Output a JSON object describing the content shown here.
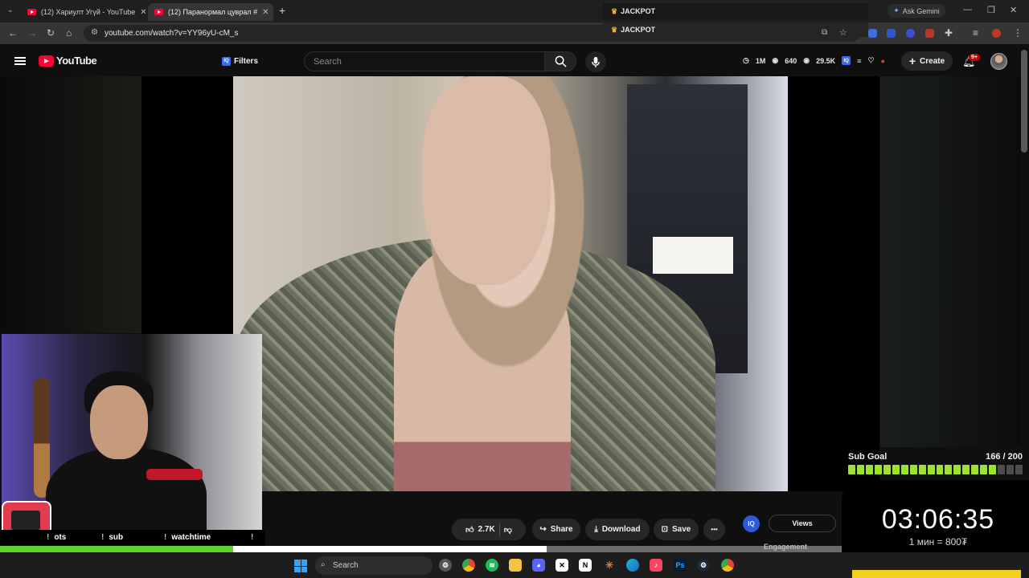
{
  "browser": {
    "tabs": [
      {
        "label": "(12) Хариулт Угүй - YouTube",
        "active": false
      },
      {
        "label": "(12) Паранормал цуврал #",
        "active": true
      }
    ],
    "new_tab": "+",
    "ask_gemini": "Ask Gemini",
    "url": "youtube.com/watch?v=YY96yU-cM_s",
    "popup_items": [
      "JACKPOT",
      "JACKPOT"
    ]
  },
  "youtube": {
    "logo_text": "YouTube",
    "filters_label": "Filters",
    "search_placeholder": "Search",
    "stats": {
      "subs": "1M",
      "views_a": "640",
      "views_b": "29.5K"
    },
    "create_label": "Create",
    "notifications_badge": "9+"
  },
  "actions": {
    "like_count": "2.7K",
    "share_label": "Share",
    "download_label": "Download",
    "save_label": "Save",
    "more_label": "•••"
  },
  "extension": {
    "iq_label": "IQ",
    "views_chip": "Views",
    "engagement_label": "Engagement"
  },
  "stream_overlay": {
    "commands": [
      {
        "bang": "!",
        "text": "ots"
      },
      {
        "bang": "!",
        "text": "sub"
      },
      {
        "bang": "!",
        "text": "watchtime"
      },
      {
        "bang": "!",
        "text": ""
      }
    ],
    "sub_goal": {
      "title": "Sub Goal",
      "count": "166 / 200",
      "current": 166,
      "target": 200
    },
    "timer": "03:06:35",
    "rate": "1 мин = 800₮",
    "colors": {
      "accent_green": "#9be32e",
      "timer_yellow": "#f0d21c"
    }
  },
  "taskbar": {
    "search_label": "Search"
  }
}
